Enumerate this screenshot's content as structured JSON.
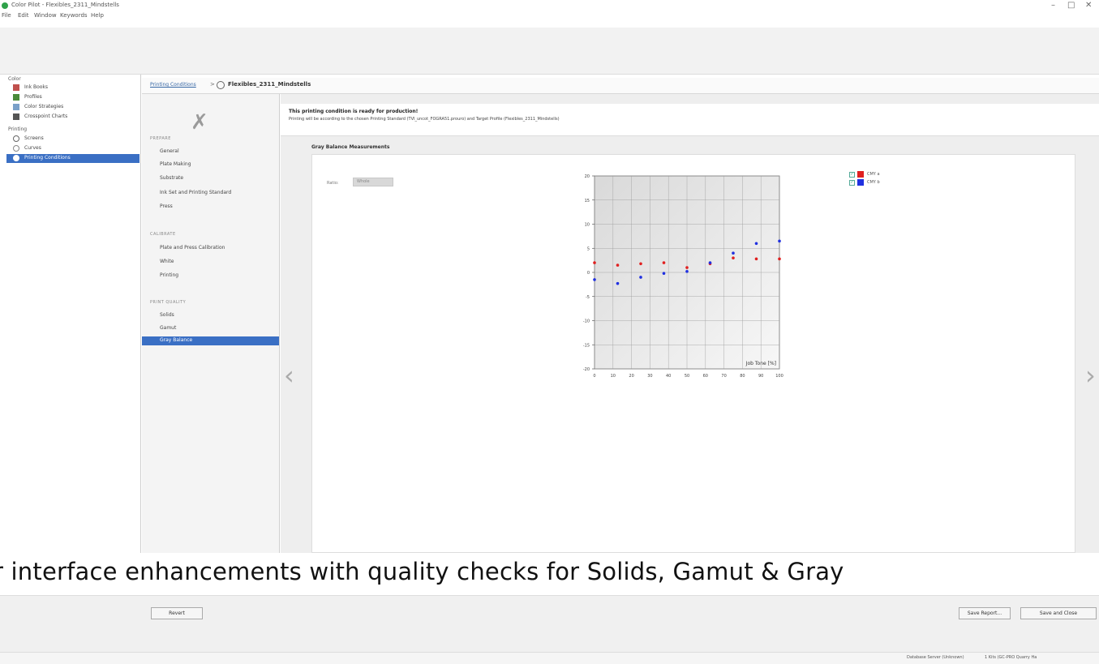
{
  "window": {
    "title": "Color Pilot - Flexibles_2311_Mindstells",
    "controls": [
      "–",
      "□",
      "✕"
    ]
  },
  "menu": [
    "File",
    "Edit",
    "Window",
    "Keywords",
    "Help"
  ],
  "sidebar": {
    "groups": [
      {
        "label": "Color",
        "items": [
          {
            "label": "Ink Books",
            "icon": "ink-book-icon",
            "color": "#c0504d"
          },
          {
            "label": "Profiles",
            "icon": "profile-icon",
            "color": "#4a8a3a"
          },
          {
            "label": "Color Strategies",
            "icon": "strategy-icon",
            "color": "#7aa0c8"
          },
          {
            "label": "Crosspoint Charts",
            "icon": "chart-icon",
            "color": "#555555"
          }
        ]
      },
      {
        "label": "Printing",
        "items": [
          {
            "label": "Screens",
            "icon": "screen-icon",
            "color": "#666666"
          },
          {
            "label": "Curves",
            "icon": "curve-icon",
            "color": "#888888"
          },
          {
            "label": "Printing Conditions",
            "icon": "printing-conditions-icon",
            "color": "#ffffff",
            "active": true
          }
        ]
      }
    ]
  },
  "breadcrumb": {
    "parent": "Printing Conditions",
    "separator": ">",
    "current": "Flexibles_2311_Mindstells"
  },
  "nav": {
    "sections": [
      {
        "head": "PREPARE",
        "items": [
          "General",
          "Plate Making",
          "Substrate",
          "Ink Set and Printing Standard",
          "Press"
        ]
      },
      {
        "head": "CALIBRATE",
        "items": [
          "Plate and Press Calibration",
          "White",
          "Printing"
        ]
      },
      {
        "head": "PRINT QUALITY",
        "items": [
          "Solids",
          "Gamut",
          "Gray Balance"
        ]
      }
    ],
    "active": "Gray Balance"
  },
  "banner": {
    "title": "This printing condition is ready for production!",
    "subtitle": "Printing will be according to the chosen Printing Standard (TVI_uncot_FOGRA51.prouro) and Target Profile (Flexibles_2311_Mindstells)"
  },
  "section_title": "Gray Balance Measurements",
  "ratio": {
    "label": "Ratio:",
    "value": "Whole"
  },
  "arrows": {
    "left": "‹",
    "right": "›"
  },
  "legend": [
    {
      "label": "CMY a",
      "color": "#e02020",
      "checked": "✓"
    },
    {
      "label": "CMY b",
      "color": "#2030e0",
      "checked": "✓"
    }
  ],
  "chart_data": {
    "type": "scatter",
    "xlabel": "Job Tone [%]",
    "ylabel": "",
    "xlim": [
      0,
      100
    ],
    "ylim": [
      -20,
      20
    ],
    "xticks": [
      0,
      10,
      20,
      30,
      40,
      50,
      60,
      70,
      80,
      90,
      100
    ],
    "yticks": [
      20,
      15,
      10,
      5,
      0,
      -5,
      -10,
      -15,
      -20
    ],
    "grid": true,
    "series": [
      {
        "name": "CMY a",
        "color": "#e02020",
        "x": [
          0,
          12.5,
          25,
          37.5,
          50,
          62.5,
          75,
          87.5,
          100
        ],
        "y": [
          2.0,
          1.5,
          1.8,
          2.0,
          1.0,
          1.8,
          3.0,
          2.8,
          2.8
        ]
      },
      {
        "name": "CMY b",
        "color": "#2030e0",
        "x": [
          0,
          12.5,
          25,
          37.5,
          50,
          62.5,
          75,
          87.5,
          100
        ],
        "y": [
          -1.5,
          -2.3,
          -1.0,
          -0.2,
          0.2,
          2.0,
          4.0,
          6.0,
          6.5
        ]
      }
    ]
  },
  "caption": "r interface enhancements with quality checks for Solids, Gamut & Gray",
  "footer": {
    "revert": "Revert",
    "save_report": "Save Report...",
    "save_close": "Save and Close"
  },
  "status": {
    "server": "Database Server (Unknown)",
    "license": "1 Kits (GC-PRO Quarry Ha"
  }
}
